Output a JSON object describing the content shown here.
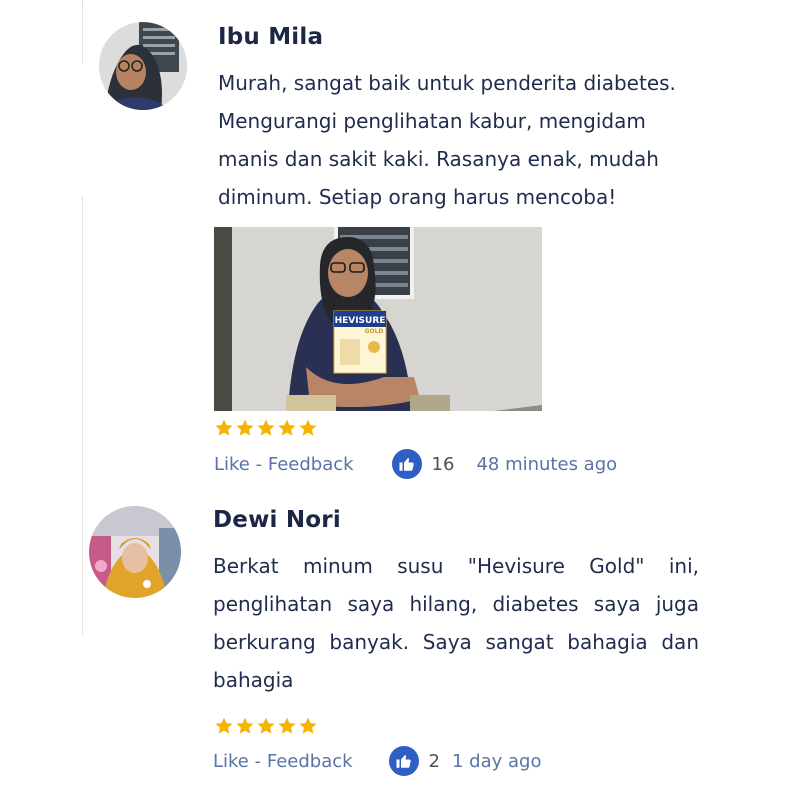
{
  "colors": {
    "name": "#1c2746",
    "text": "#1f2c4e",
    "link": "#5a73a6",
    "like_blue": "#2f5fc4",
    "star": "#f4b400"
  },
  "reviews": [
    {
      "name": "Ibu Mila",
      "lines": [
        "Murah, sangat baik untuk penderita diabetes.",
        "Mengurangi penglihatan kabur, mengidam",
        "manis dan sakit kaki. Rasanya enak, mudah",
        "diminum. Setiap orang harus mencoba!"
      ],
      "product_box_label": "HEVISURE",
      "product_box_sub": "GOLD",
      "rating": 5,
      "action": "Like - Feedback",
      "likes": "16",
      "time": "48 minutes ago"
    },
    {
      "name": "Dewi Nori",
      "lines": [
        "Berkat minum susu \"Hevisure Gold\" ini,",
        "penglihatan saya hilang, diabetes saya juga",
        "berkurang banyak. Saya sangat bahagia dan",
        "bahagia"
      ],
      "rating": 5,
      "action": "Like - Feedback",
      "likes": "2",
      "time": "1 day ago"
    }
  ]
}
